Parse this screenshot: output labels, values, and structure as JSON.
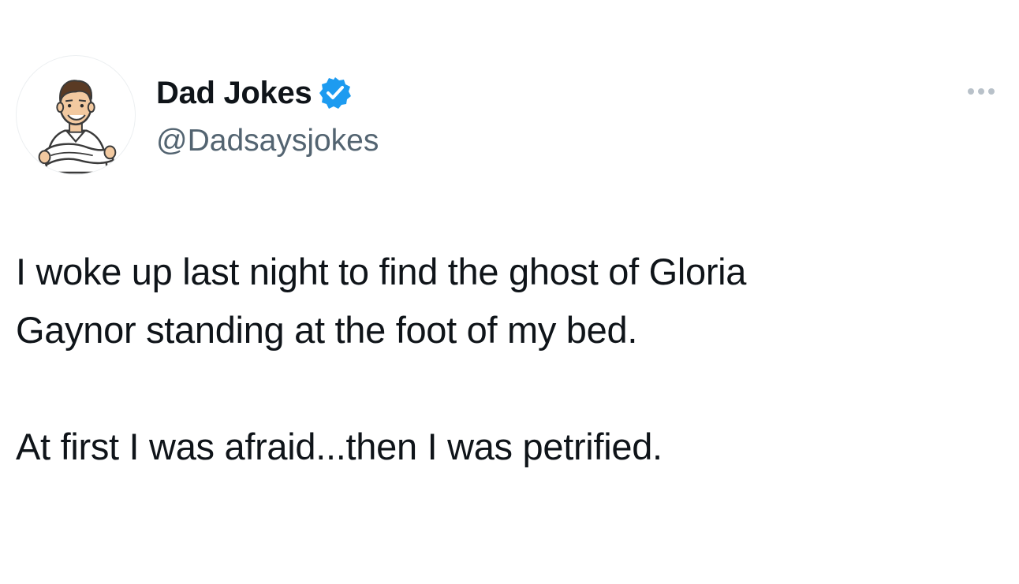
{
  "author": {
    "display_name": "Dad Jokes",
    "handle": "@Dadsaysjokes",
    "verified": true,
    "avatar_icon": "cartoon-man-arms-crossed-avatar",
    "badge_icon": "verified-badge-icon"
  },
  "tweet": {
    "lines": [
      "I woke up last night to find the ghost of Gloria",
      "Gaynor standing at the foot of my bed.",
      "At first I was afraid...then I was petrified."
    ]
  },
  "controls": {
    "more_icon": "more-options-icon"
  },
  "colors": {
    "text": "#0f1419",
    "secondary_text": "#536471",
    "verified_blue": "#1d9bf0",
    "more_dots": "#b8c1c9",
    "background": "#ffffff"
  }
}
